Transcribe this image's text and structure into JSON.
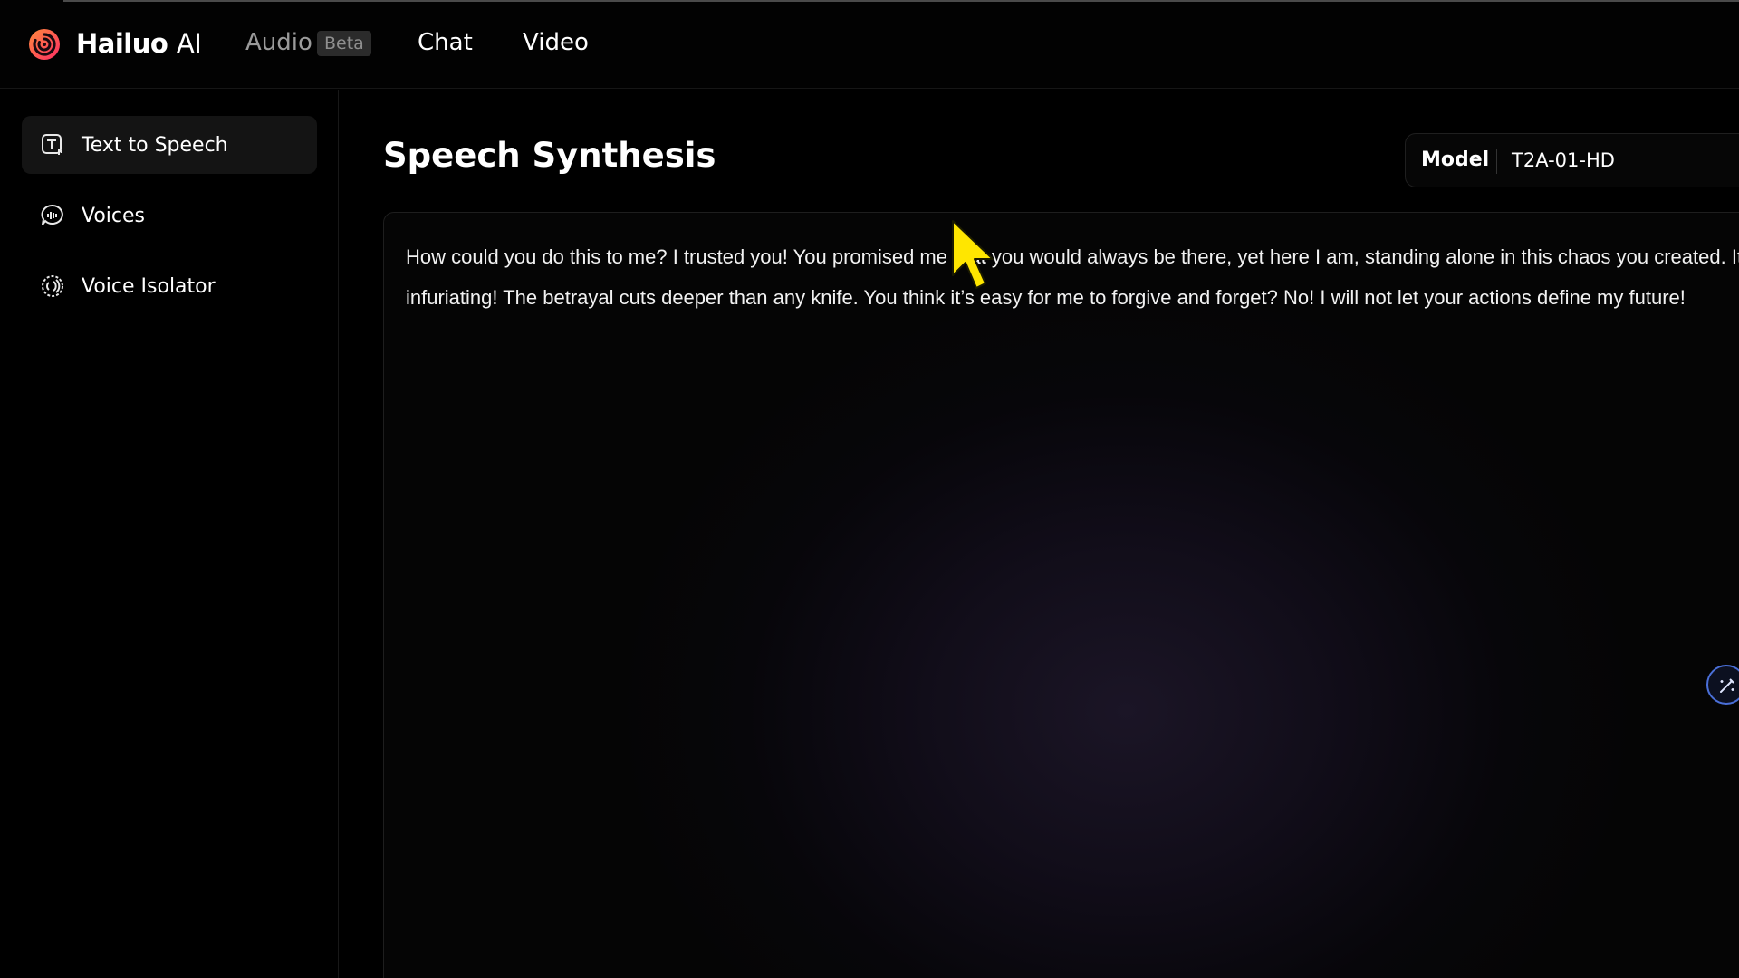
{
  "header": {
    "brand_name": "Hailuo",
    "brand_suffix": "AI",
    "nav": {
      "audio": "Audio",
      "audio_badge": "Beta",
      "chat": "Chat",
      "video": "Video"
    }
  },
  "sidebar": {
    "items": [
      {
        "label": "Text to Speech",
        "icon": "text-speech-icon",
        "active": true
      },
      {
        "label": "Voices",
        "icon": "voices-icon",
        "active": false
      },
      {
        "label": "Voice Isolator",
        "icon": "voice-isolator-icon",
        "active": false
      }
    ]
  },
  "main": {
    "title": "Speech Synthesis",
    "model": {
      "label": "Model",
      "value": "T2A-01-HD"
    },
    "editor_text": "How could you do this to me? I trusted you! You promised me that you would always be there, yet here I am, standing alone in this chaos you created. It’s infuriating! The betrayal cuts deeper than any knife. You think it’s easy for me to forgive and forget? No! I will not let your actions define my future!"
  },
  "colors": {
    "background": "#000000",
    "accent_ring": "#4a6fd8",
    "logo_gradient": [
      "#ff3d55",
      "#ff8a3d"
    ],
    "cursor": "#ffe600"
  }
}
